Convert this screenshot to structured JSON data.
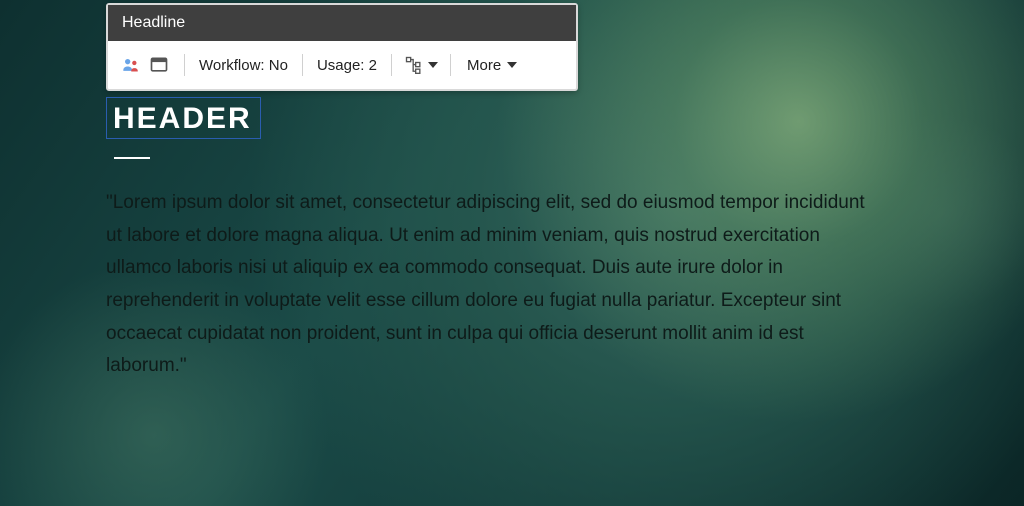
{
  "toolbar": {
    "title": "Headline",
    "workflow_label": "Workflow:",
    "workflow_value": "No",
    "usage_label": "Usage:",
    "usage_value": "2",
    "more_label": "More"
  },
  "header": {
    "text": "HEADER"
  },
  "body": {
    "text": "\"Lorem ipsum dolor sit amet, consectetur adipiscing elit, sed do eiusmod tempor incididunt ut labore et dolore magna aliqua. Ut enim ad minim veniam, quis nostrud exercitation ullamco laboris nisi ut aliquip ex ea commodo consequat. Duis aute irure dolor in reprehenderit in voluptate velit esse cillum dolore eu fugiat nulla pariatur. Excepteur sint occaecat cupidatat non proident, sunt in culpa qui officia deserunt mollit anim id est laborum.\""
  },
  "icons": {
    "users": "users-icon",
    "window": "window-icon",
    "tree": "tree-icon"
  },
  "colors": {
    "panel_title_bg": "#3f3f3f",
    "selection_border": "#2a5db0",
    "text_dark": "#0e1b19"
  }
}
